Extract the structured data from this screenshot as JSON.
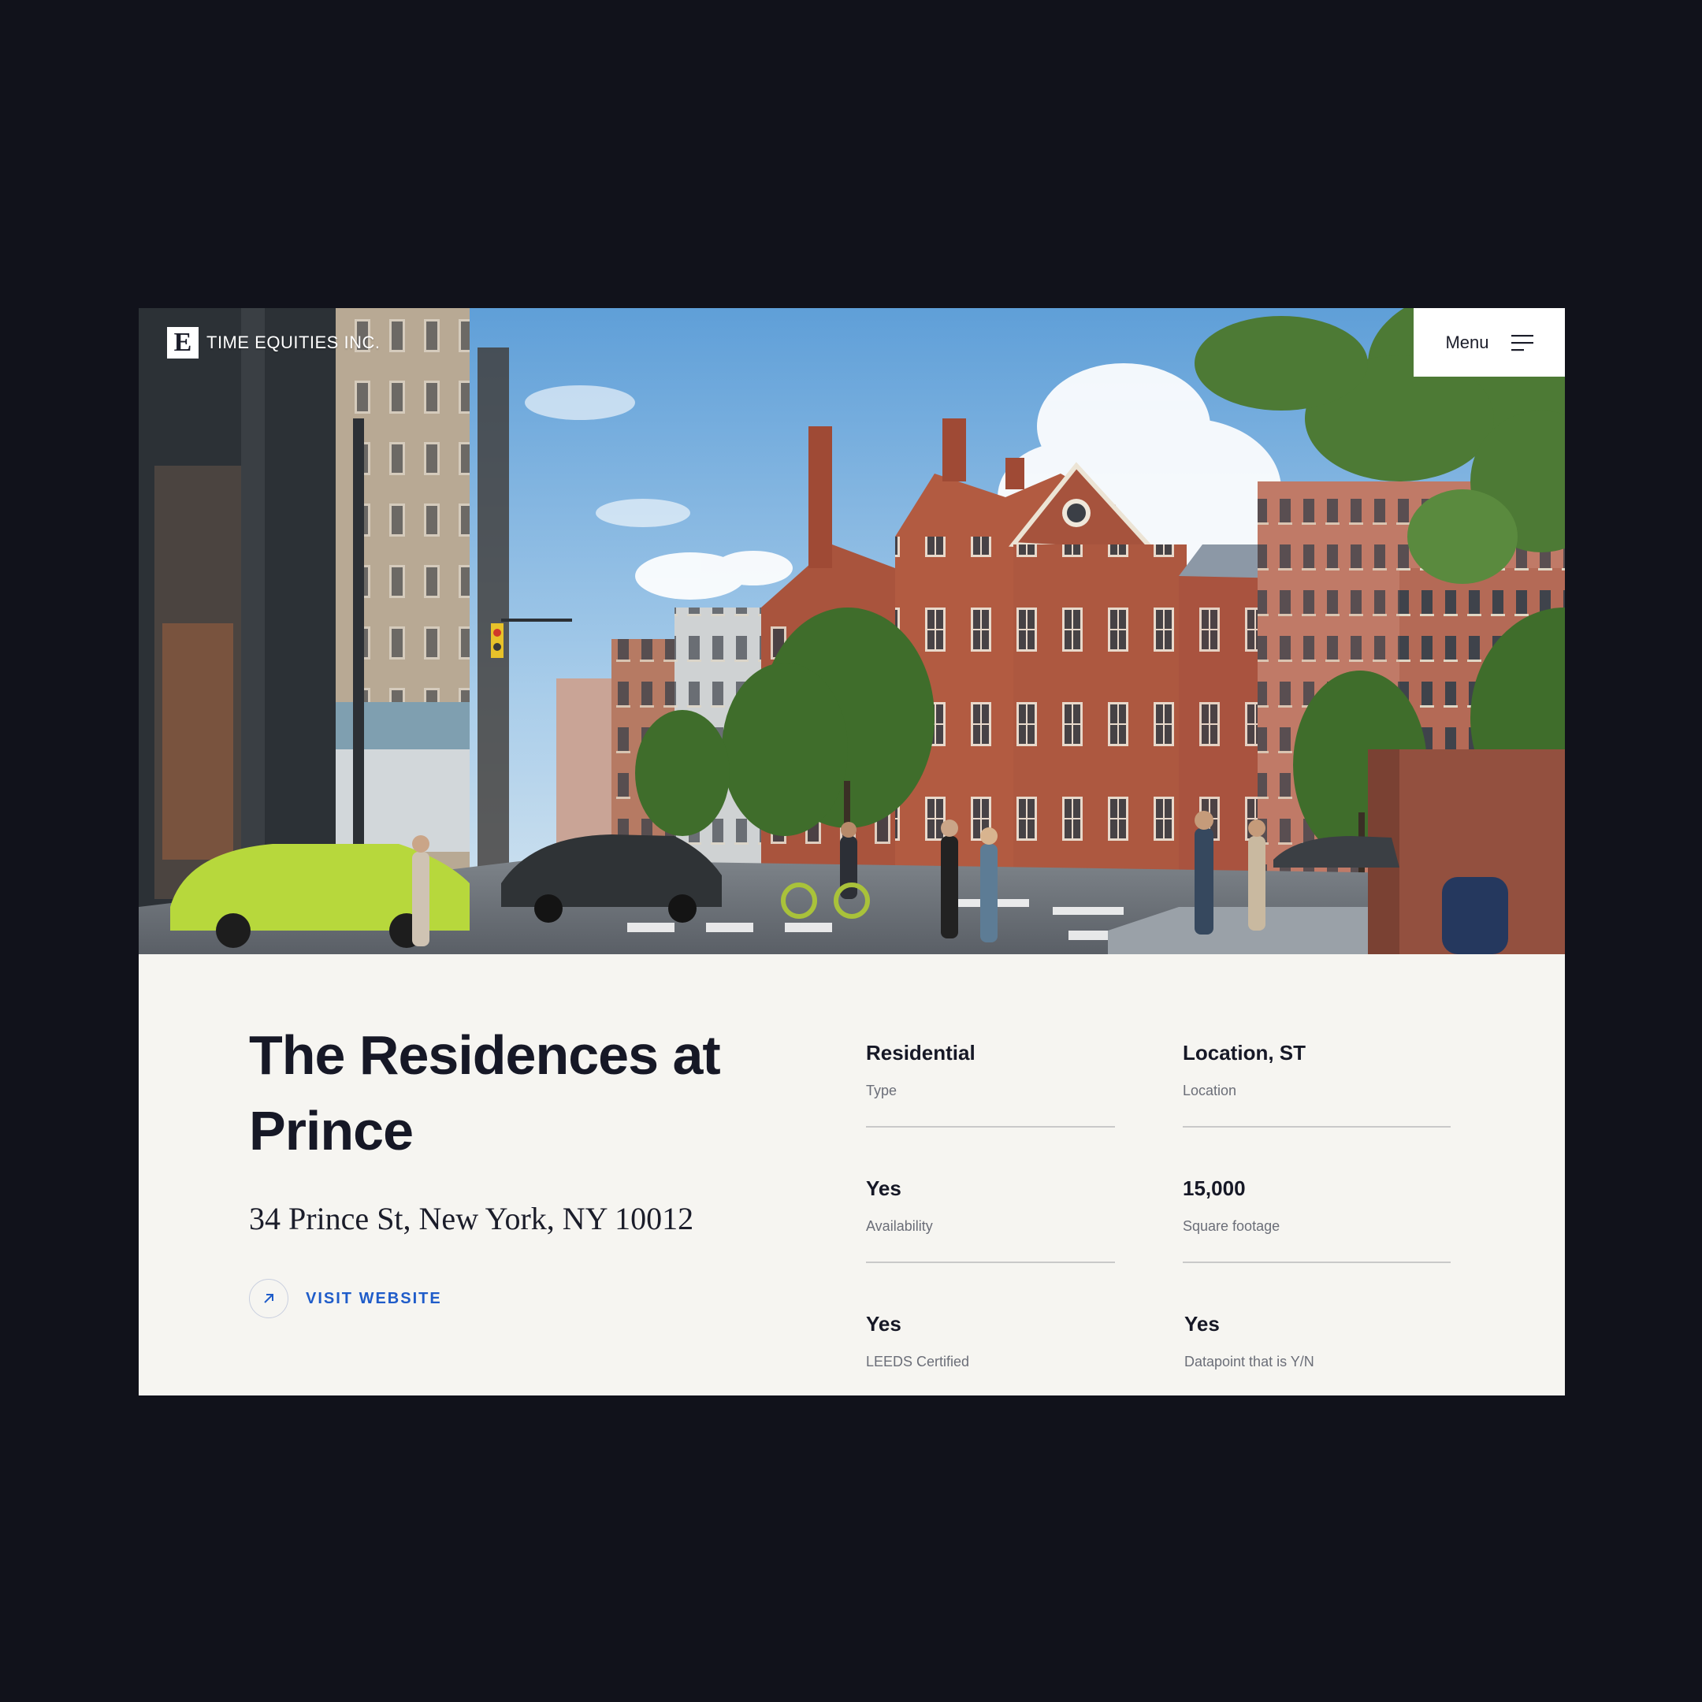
{
  "header": {
    "logo_letter": "E",
    "logo_text": "TIME EQUITIES INC.",
    "menu_label": "Menu"
  },
  "property": {
    "title": "The Residences at Prince",
    "address": "34 Prince St, New York, NY 10012",
    "visit_label": "VISIT WEBSITE"
  },
  "stats": [
    {
      "value": "Residential",
      "label": "Type"
    },
    {
      "value": "Location, ST",
      "label": "Location"
    },
    {
      "value": "Yes",
      "label": "Availability"
    },
    {
      "value": "15,000",
      "label": "Square footage"
    },
    {
      "value": "Yes",
      "label": "LEEDS Certified"
    },
    {
      "value": "Yes",
      "label": "Datapoint that is Y/N"
    }
  ],
  "colors": {
    "background": "#11121b",
    "panel": "#f6f5f1",
    "accent": "#1f5cc9",
    "text": "#161826"
  },
  "icons": {
    "menu": "hamburger-icon",
    "visit": "arrow-up-right-icon"
  }
}
